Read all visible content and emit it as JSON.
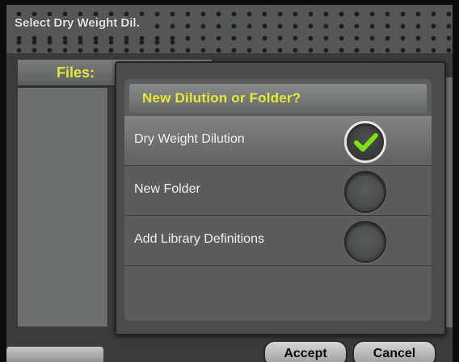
{
  "window": {
    "title": "Select Dry Weight Dil."
  },
  "files": {
    "label": "Files:"
  },
  "dialog": {
    "title": "New Dilution or Folder?",
    "options": [
      {
        "label": "Dry Weight Dilution",
        "selected": true,
        "icon": "checkmark-icon"
      },
      {
        "label": "New Folder",
        "selected": false
      },
      {
        "label": "Add Library Definitions",
        "selected": false
      }
    ]
  },
  "buttons": {
    "accept": "Accept",
    "cancel": "Cancel"
  },
  "colors": {
    "accent_yellow": "#e8e83a",
    "check_green": "#7de01a"
  }
}
